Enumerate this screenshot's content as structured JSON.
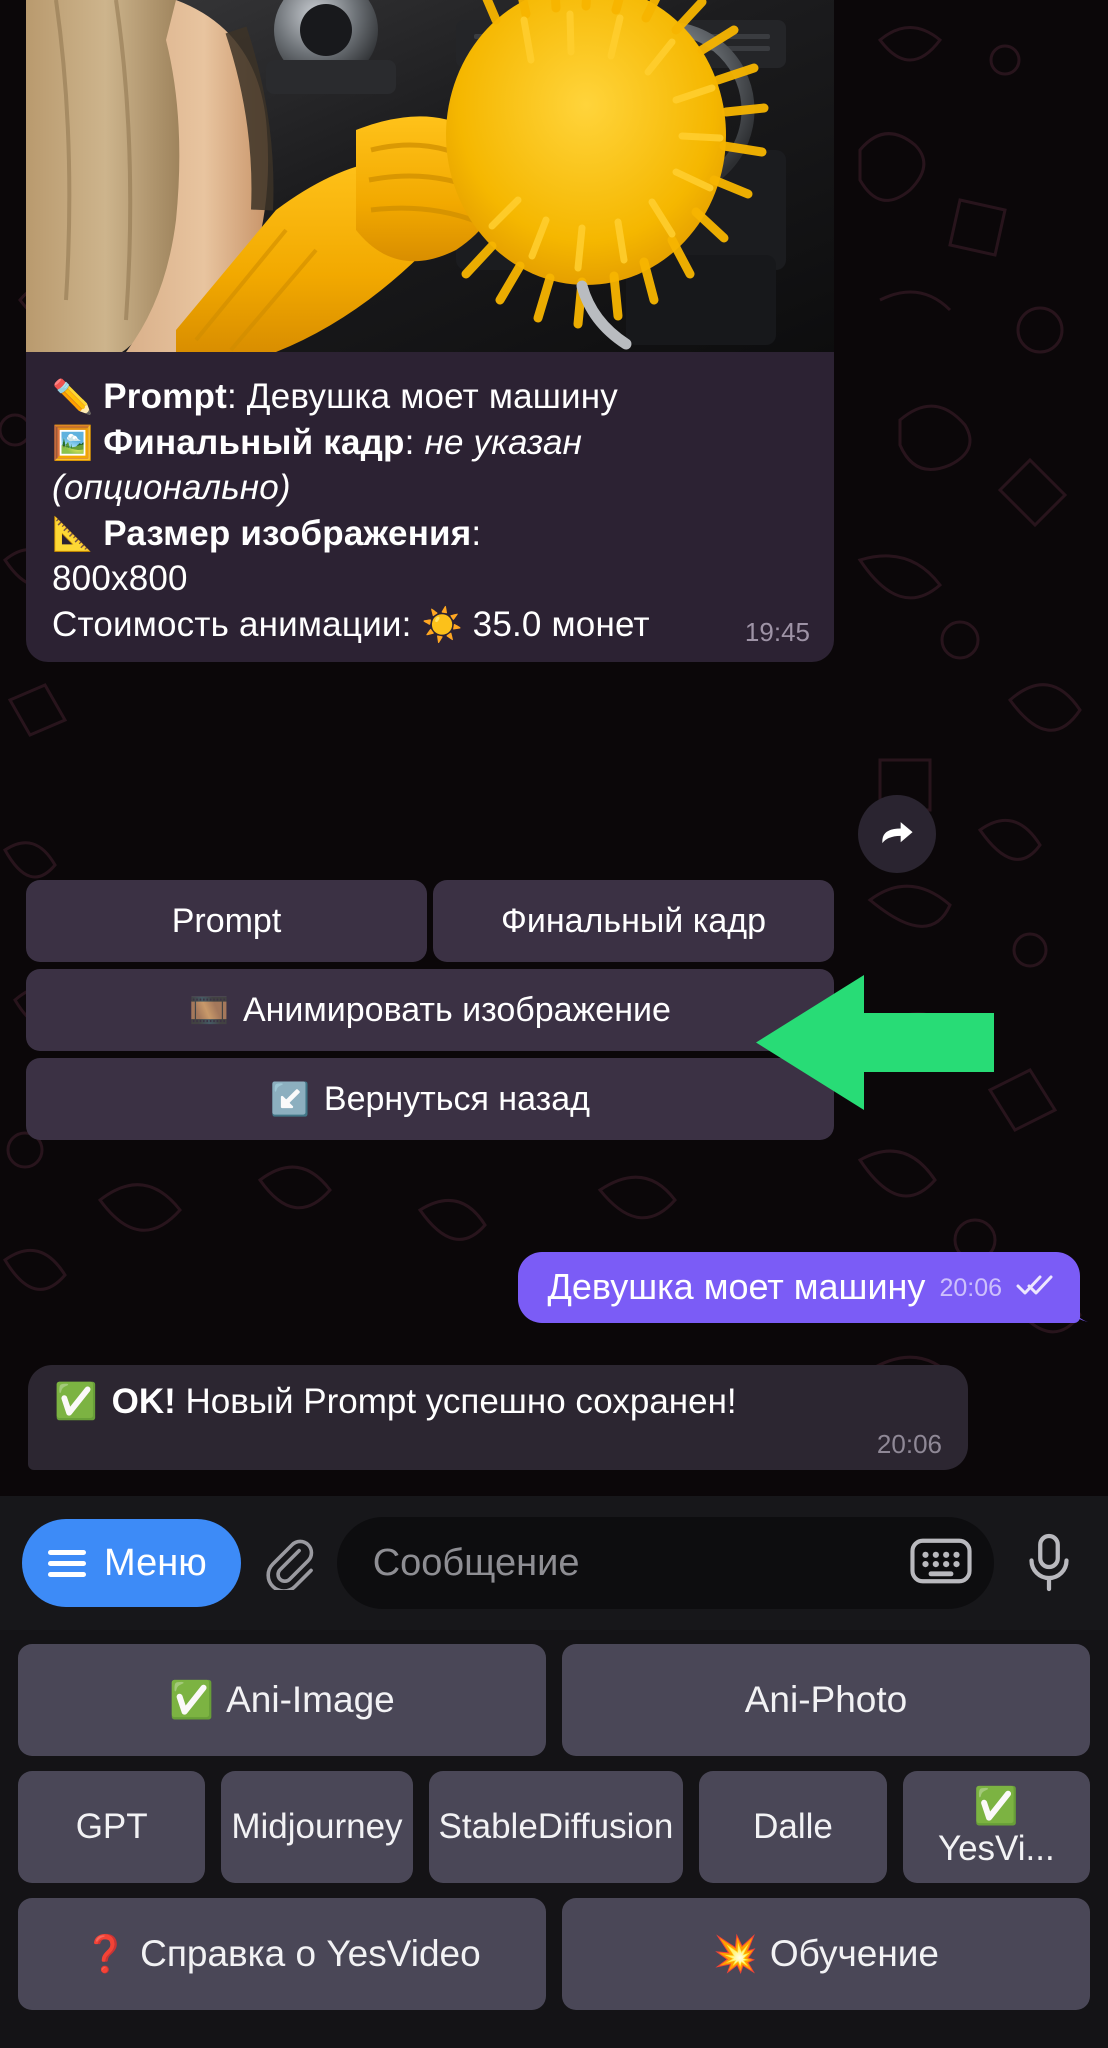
{
  "bot_message": {
    "photo_alt": "woman-washing-car-interior-yellow-gloves",
    "lines": [
      {
        "icon": "✏️",
        "icon_name": "pencil-icon",
        "bold": "Prompt",
        "sep": ": ",
        "value": "Девушка моет машину",
        "style": "normal"
      },
      {
        "icon": "🖼️",
        "icon_name": "framed-picture-icon",
        "bold": "Финальный кадр",
        "sep": ": ",
        "value": "не указан (опционально)",
        "style": "italic"
      },
      {
        "icon": "📐",
        "icon_name": "triangular-ruler-icon",
        "bold": "Размер изображения",
        "sep": ": ",
        "value": "800x800",
        "style": "normal"
      }
    ],
    "cost_label": "Стоимость анимации:",
    "cost_icon": "☀️",
    "cost_value": "35.0",
    "cost_unit": "монет",
    "time": "19:45"
  },
  "inline_keyboard": {
    "row1": [
      {
        "label": "Prompt",
        "icon": ""
      },
      {
        "label": "Финальный кадр",
        "icon": ""
      }
    ],
    "row2": [
      {
        "label": "Анимировать изображение",
        "icon": "🎞️",
        "icon_name": "film-frames-icon"
      }
    ],
    "row3": [
      {
        "label": "Вернуться назад",
        "icon": "↙️",
        "icon_name": "down-left-arrow-icon"
      }
    ]
  },
  "forward_button": {
    "icon_name": "forward-arrow-icon"
  },
  "annotation": {
    "arrow_color": "#28DC76",
    "direction": "left",
    "points_at": "Анимировать изображение"
  },
  "user_message": {
    "text": "Девушка моет машину",
    "time": "20:06",
    "status_ticks": "✓✓",
    "bubble_color": "#7B5CF6"
  },
  "confirmation_message": {
    "icon": "✅",
    "icon_name": "check-mark-button-icon",
    "bold_part": "OK!",
    "rest": " Новый Prompt успешно сохранен!",
    "time": "20:06"
  },
  "input_bar": {
    "menu_label": "Меню",
    "menu_color": "#3D8BF7",
    "attach_icon_name": "paperclip-icon",
    "message_placeholder": "Сообщение",
    "keyboard_icon_name": "keyboard-icon",
    "mic_icon_name": "microphone-icon"
  },
  "reply_keyboard": {
    "rows": [
      [
        {
          "label": "Ani-Image",
          "icon": "✅",
          "icon_name": "check-mark-button-icon",
          "selected": true
        },
        {
          "label": "Ani-Photo",
          "icon": "",
          "icon_name": "",
          "selected": false
        }
      ],
      [
        {
          "label": "GPT",
          "icon": "",
          "icon_name": "",
          "selected": false
        },
        {
          "label": "Midjourney",
          "icon": "",
          "icon_name": "",
          "selected": false
        },
        {
          "label": "StableDiffusion",
          "icon": "",
          "icon_name": "",
          "selected": false
        },
        {
          "label": "Dalle",
          "icon": "",
          "icon_name": "",
          "selected": false
        },
        {
          "label": "YesVi...",
          "icon": "✅",
          "icon_name": "check-mark-button-icon",
          "selected": true
        }
      ],
      [
        {
          "label": "Справка о YesVideo",
          "icon": "❓",
          "icon_name": "question-mark-icon",
          "selected": false
        },
        {
          "label": "Обучение",
          "icon": "💥",
          "icon_name": "collision-icon",
          "selected": false
        }
      ]
    ]
  }
}
